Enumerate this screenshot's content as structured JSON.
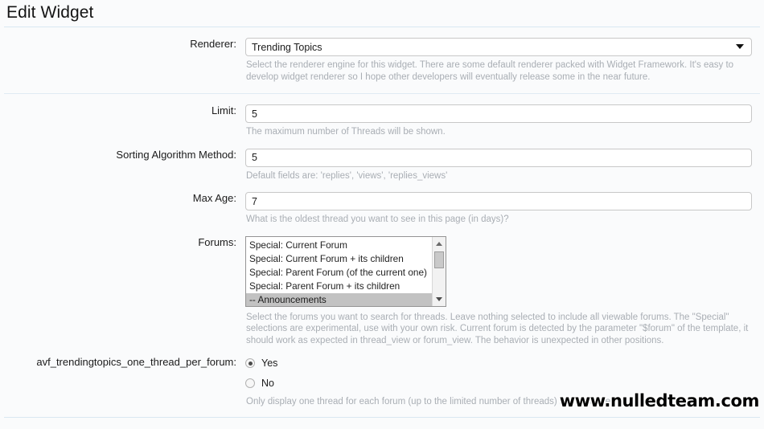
{
  "page": {
    "title": "Edit Widget"
  },
  "fields": {
    "renderer": {
      "label": "Renderer:",
      "value": "Trending Topics",
      "hint": "Select the renderer engine for this widget. There are some default renderer packed with Widget Framework. It's easy to develop widget renderer so I hope other developers will eventually release some in the near future."
    },
    "limit": {
      "label": "Limit:",
      "value": "5",
      "hint": "The maximum number of Threads will be shown."
    },
    "sorting": {
      "label": "Sorting Algorithm Method:",
      "value": "5",
      "hint": "Default fields are: 'replies', 'views', 'replies_views'"
    },
    "max_age": {
      "label": "Max Age:",
      "value": "7",
      "hint": "What is the oldest thread you want to see in this page (in days)?"
    },
    "forums": {
      "label": "Forums:",
      "options": [
        {
          "text": "Special: Current Forum",
          "selected": false
        },
        {
          "text": "Special: Current Forum + its children",
          "selected": false
        },
        {
          "text": "Special: Parent Forum (of the current one)",
          "selected": false
        },
        {
          "text": "Special: Parent Forum + its children",
          "selected": false
        },
        {
          "text": "-- Announcements",
          "selected": true
        }
      ],
      "hint": "Select the forums you want to search for threads. Leave nothing selected to include all viewable forums. The \"Special\" selections are experimental, use with your own risk. Current forum is detected by the parameter \"$forum\" of the template, it should work as expected in thread_view or forum_view. The behavior is unexpected in other positions."
    },
    "one_thread_per_forum": {
      "label": "avf_trendingtopics_one_thread_per_forum:",
      "options": [
        {
          "label": "Yes",
          "checked": true
        },
        {
          "label": "No",
          "checked": false
        }
      ],
      "hint": "Only display one thread for each forum (up to the limited number of threads) in this widget."
    }
  },
  "watermark": {
    "text": "www.nulledteam.com"
  },
  "colors": {
    "background": "#fafbfc",
    "rule": "#d9e8f2",
    "label_text": "#1b1b1b",
    "hint_text": "#a9aeb4",
    "input_border": "#c8c8c8",
    "listbox_border": "#949494",
    "listbox_selected": "#c2c2c2"
  }
}
